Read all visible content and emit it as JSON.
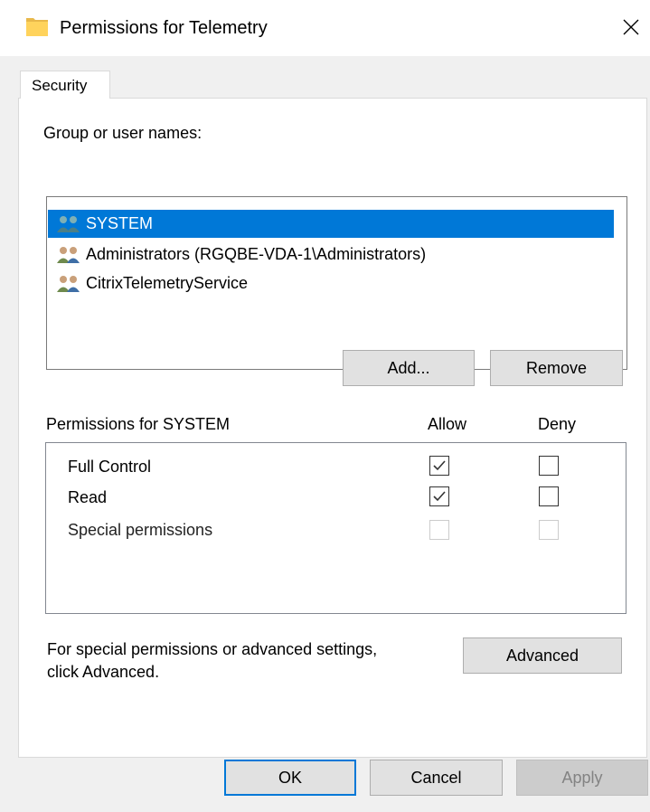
{
  "window": {
    "title": "Permissions for Telemetry",
    "icon": "folder-icon"
  },
  "tabs": [
    {
      "label": "Security",
      "selected": true
    }
  ],
  "group_section": {
    "label": "Group or user names:",
    "users": [
      {
        "name": "SYSTEM",
        "selected": true
      },
      {
        "name": "Administrators (RGQBE-VDA-1\\Administrators)",
        "selected": false
      },
      {
        "name": "CitrixTelemetryService",
        "selected": false
      }
    ],
    "add_label": "Add...",
    "remove_label": "Remove"
  },
  "permissions": {
    "header": "Permissions for SYSTEM",
    "allow_header": "Allow",
    "deny_header": "Deny",
    "rows": [
      {
        "name": "Full Control",
        "allow": true,
        "deny": false,
        "enabled": true
      },
      {
        "name": "Read",
        "allow": true,
        "deny": false,
        "enabled": true
      },
      {
        "name": "Special permissions",
        "allow": false,
        "deny": false,
        "enabled": false
      }
    ]
  },
  "advanced": {
    "text_line1": "For special permissions or advanced settings,",
    "text_line2": "click Advanced.",
    "button_label": "Advanced"
  },
  "footer": {
    "ok_label": "OK",
    "cancel_label": "Cancel",
    "apply_label": "Apply"
  },
  "colors": {
    "selection": "#0078d7",
    "window_bg": "#f0f0f0",
    "panel_bg": "#ffffff",
    "folder": "#ffd35c"
  }
}
